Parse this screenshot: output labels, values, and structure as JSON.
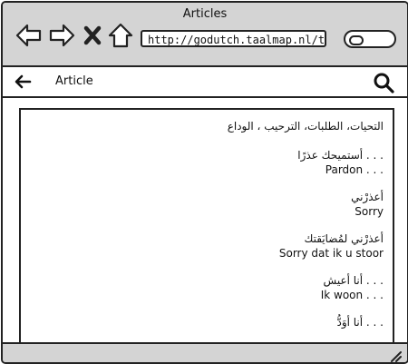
{
  "window": {
    "title": "Articles"
  },
  "browser": {
    "url": "http://godutch.taalmap.nl/topic/",
    "icons": [
      "back-arrow-icon",
      "forward-arrow-icon",
      "close-icon",
      "home-icon",
      "search-icon"
    ]
  },
  "appbar": {
    "title": "Article"
  },
  "article": {
    "heading": "التحيات، الطلبات، الترحيب ، الوداع",
    "phrases": [
      {
        "ar": ". . . أستميحك عذرًا",
        "nl": "Pardon . . ."
      },
      {
        "ar": "أعذرْني",
        "nl": "Sorry"
      },
      {
        "ar": "أعذرْني لمُضايَقتك",
        "nl": "Sorry dat ik u stoor"
      },
      {
        "ar": ". . . أنا أعيش",
        "nl": "Ik woon . . ."
      },
      {
        "ar": ". . . أنا أوَدُّ",
        "nl": ""
      }
    ]
  },
  "colors": {
    "chrome": "#d4d4d4",
    "border": "#222222",
    "background": "#ffffff"
  }
}
